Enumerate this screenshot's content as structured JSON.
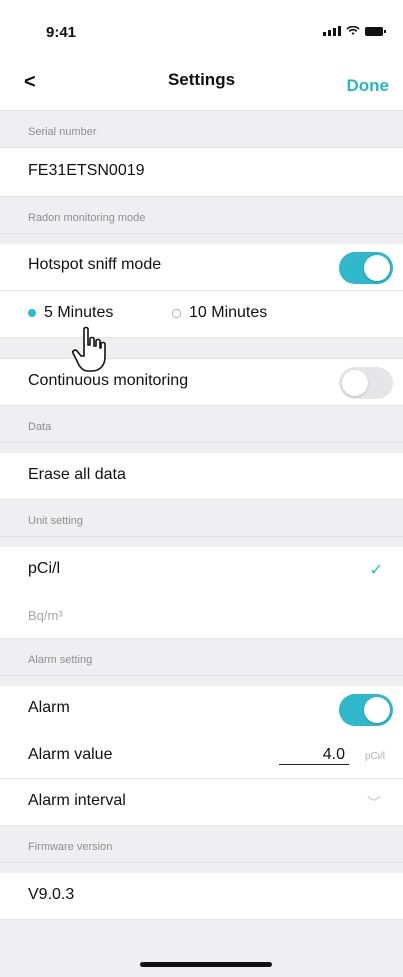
{
  "status": {
    "time": "9:41"
  },
  "nav": {
    "back": "<",
    "title": "Settings",
    "done": "Done"
  },
  "sections": {
    "serial": {
      "header": "Serial number",
      "value": "FE31ETSN0019"
    },
    "radon": {
      "header": "Radon monitoring mode",
      "hotspot_label": "Hotspot sniff mode",
      "hotspot_on": true,
      "opt1": "5 Minutes",
      "opt2": "10 Minutes",
      "selected": "5 Minutes",
      "continuous_label": "Continuous monitoring",
      "continuous_on": false
    },
    "data": {
      "header": "Data",
      "erase_label": "Erase all data"
    },
    "unit": {
      "header": "Unit setting",
      "unit1": "pCi/l",
      "unit2": "Bq/m³",
      "selected": "pCi/l"
    },
    "alarm": {
      "header": "Alarm setting",
      "alarm_label": "Alarm",
      "alarm_on": true,
      "value_label": "Alarm value",
      "value": "4.0",
      "value_unit": "pCi/l",
      "interval_label": "Alarm interval"
    },
    "firmware": {
      "header": "Firmware version",
      "value": "V9.0.3"
    }
  },
  "colors": {
    "accent": "#2fb8c9",
    "background": "#efeff1"
  }
}
